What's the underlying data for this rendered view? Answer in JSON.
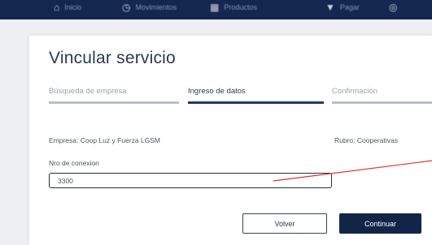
{
  "header": {
    "nav": [
      {
        "icon": "home-icon",
        "glyph": "⌂",
        "label": "Inicio"
      },
      {
        "icon": "clock-icon",
        "glyph": "◷",
        "label": "Movimientos"
      },
      {
        "icon": "grid-icon",
        "glyph": "▦",
        "label": "Productos"
      },
      {
        "icon": "chevron-down-icon",
        "glyph": "▼",
        "label": "Pagar"
      },
      {
        "icon": "user-icon",
        "glyph": "◎",
        "label": ""
      }
    ]
  },
  "page": {
    "title": "Vincular servicio"
  },
  "steps": [
    {
      "label": "Búsqueda de empresa",
      "state": "done"
    },
    {
      "label": "Ingreso de datos",
      "state": "active"
    },
    {
      "label": "Confirmación",
      "state": "pending"
    }
  ],
  "summary": {
    "empresa": "Empresa: Coop Luz y Fuerza LGSM",
    "rubro": "Rubro: Cooperativas"
  },
  "form": {
    "field_label": "Nro de conexion",
    "field_value": "3300"
  },
  "actions": {
    "back_label": "Volver",
    "continue_label": "Continuar"
  },
  "colors": {
    "header_bg": "#14274f",
    "primary": "#122448",
    "active_step": "#1c3a6e",
    "annotation": "#e0322a"
  }
}
